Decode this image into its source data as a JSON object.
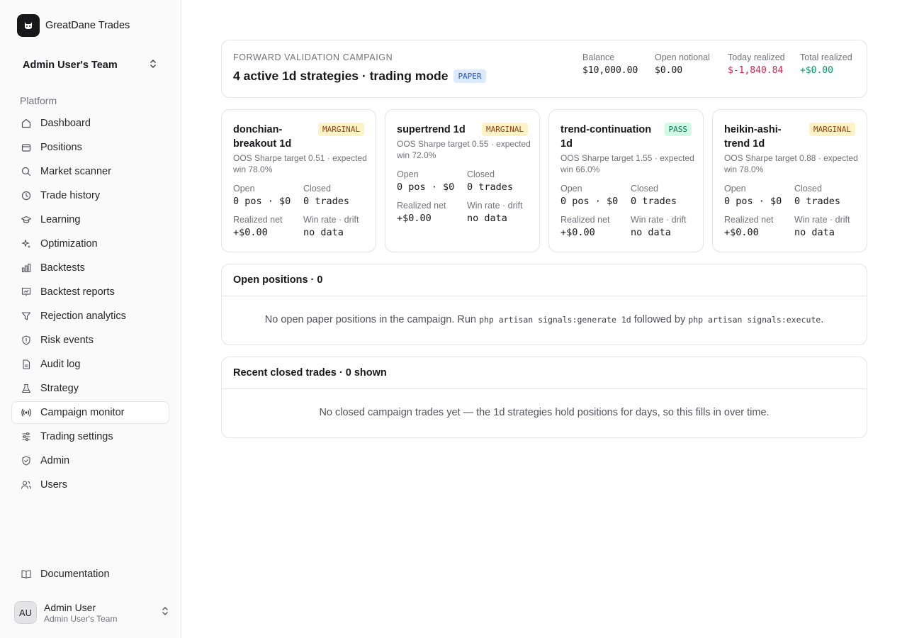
{
  "brand": {
    "name": "GreatDane Trades",
    "logo_icon": "dog-icon"
  },
  "team": {
    "name": "Admin User's Team"
  },
  "sidebar": {
    "section": "Platform",
    "items": [
      {
        "label": "Dashboard",
        "icon": "home-icon",
        "active": false
      },
      {
        "label": "Positions",
        "icon": "wallet-icon",
        "active": false
      },
      {
        "label": "Market scanner",
        "icon": "search-icon",
        "active": false
      },
      {
        "label": "Trade history",
        "icon": "clock-icon",
        "active": false
      },
      {
        "label": "Learning",
        "icon": "graduation-cap-icon",
        "active": false
      },
      {
        "label": "Optimization",
        "icon": "sparkles-icon",
        "active": false
      },
      {
        "label": "Backtests",
        "icon": "bar-chart-icon",
        "active": false
      },
      {
        "label": "Backtest reports",
        "icon": "presentation-chart-icon",
        "active": false
      },
      {
        "label": "Rejection analytics",
        "icon": "filter-icon",
        "active": false
      },
      {
        "label": "Risk events",
        "icon": "shield-alert-icon",
        "active": false
      },
      {
        "label": "Audit log",
        "icon": "file-icon",
        "active": false
      },
      {
        "label": "Strategy",
        "icon": "flask-icon",
        "active": false
      },
      {
        "label": "Campaign monitor",
        "icon": "radio-icon",
        "active": true
      },
      {
        "label": "Trading settings",
        "icon": "sliders-icon",
        "active": false
      },
      {
        "label": "Admin",
        "icon": "shield-check-icon",
        "active": false
      },
      {
        "label": "Users",
        "icon": "users-icon",
        "active": false
      }
    ],
    "docs": {
      "label": "Documentation",
      "icon": "book-open-icon"
    },
    "user": {
      "initials": "AU",
      "name": "Admin User",
      "team": "Admin User's Team"
    }
  },
  "campaign": {
    "eyebrow": "Forward validation campaign",
    "title": "4 active 1d strategies · trading mode",
    "mode_badge": "PAPER",
    "stats": [
      {
        "label": "Balance",
        "value": "$10,000.00",
        "tone": "neutral"
      },
      {
        "label": "Open notional",
        "value": "$0.00",
        "tone": "neutral"
      },
      {
        "label": "Today realized",
        "value": "$-1,840.84",
        "tone": "negative"
      },
      {
        "label": "Total realized",
        "value": "+$0.00",
        "tone": "positive"
      }
    ]
  },
  "strategies": [
    {
      "name": "donchian-breakout 1d",
      "badge": "MARGINAL",
      "status": "marginal",
      "desc": "OOS Sharpe target 0.51 · expected win 78.0%",
      "open_label": "Open",
      "open": "0 pos · $0",
      "closed_label": "Closed",
      "closed": "0 trades",
      "net_label": "Realized net",
      "net": "+$0.00",
      "wr_label": "Win rate · drift",
      "wr": "no data"
    },
    {
      "name": "supertrend 1d",
      "badge": "MARGINAL",
      "status": "marginal",
      "desc": "OOS Sharpe target 0.55 · expected win 72.0%",
      "open_label": "Open",
      "open": "0 pos · $0",
      "closed_label": "Closed",
      "closed": "0 trades",
      "net_label": "Realized net",
      "net": "+$0.00",
      "wr_label": "Win rate · drift",
      "wr": "no data"
    },
    {
      "name": "trend-continuation 1d",
      "badge": "PASS",
      "status": "pass",
      "desc": "OOS Sharpe target 1.55 · expected win 66.0%",
      "open_label": "Open",
      "open": "0 pos · $0",
      "closed_label": "Closed",
      "closed": "0 trades",
      "net_label": "Realized net",
      "net": "+$0.00",
      "wr_label": "Win rate · drift",
      "wr": "no data"
    },
    {
      "name": "heikin-ashi-trend 1d",
      "badge": "MARGINAL",
      "status": "marginal",
      "desc": "OOS Sharpe target 0.88 · expected win 78.0%",
      "open_label": "Open",
      "open": "0 pos · $0",
      "closed_label": "Closed",
      "closed": "0 trades",
      "net_label": "Realized net",
      "net": "+$0.00",
      "wr_label": "Win rate · drift",
      "wr": "no data"
    }
  ],
  "open_positions": {
    "title": "Open positions · 0",
    "empty_prefix": "No open paper positions in the campaign. Run",
    "cmd1": "php artisan signals:generate 1d",
    "empty_mid": "followed by",
    "cmd2": "php artisan signals:execute",
    "empty_suffix": "."
  },
  "closed_trades": {
    "title": "Recent closed trades · 0 shown",
    "empty": "No closed campaign trades yet — the 1d strategies hold positions for days, so this fills in over time."
  },
  "colors": {
    "negative": "#e11d48",
    "positive": "#059669",
    "paper_badge": "#dbeafe",
    "marginal_badge": "#fef3c7",
    "pass_badge": "#d1fae5"
  }
}
